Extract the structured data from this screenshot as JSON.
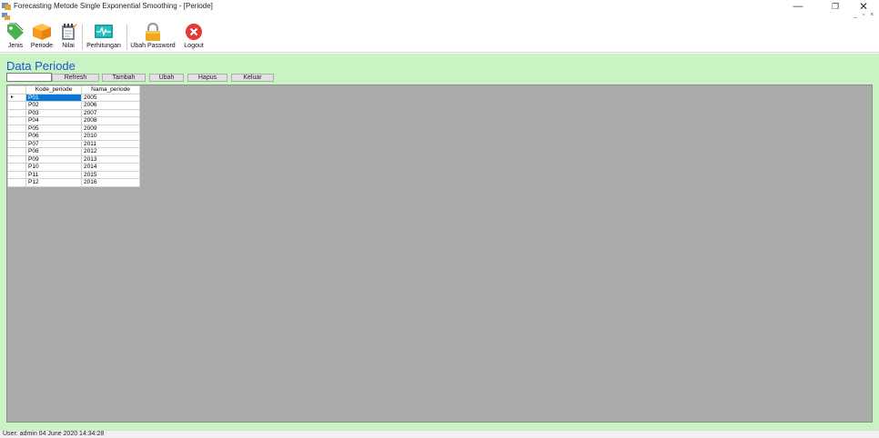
{
  "window": {
    "title": "Forecasting Metode Single Exponential Smoothing - [Periode]",
    "controls": {
      "minimize": "—",
      "restore": "❐",
      "close": "✕"
    },
    "mdi_controls": "_ ▫ ×"
  },
  "toolbar": {
    "items": [
      {
        "label": "Jenis",
        "icon": "tag-icon",
        "color": "#4caf50"
      },
      {
        "label": "Periode",
        "icon": "box-icon",
        "color": "#f5a623"
      },
      {
        "label": "Nilai",
        "icon": "notepad-icon",
        "color": "#7b8798"
      },
      {
        "label": "Perhitungan",
        "icon": "pulse-monitor-icon",
        "color": "#1aa3a3"
      },
      {
        "label": "Ubah Password",
        "icon": "padlock-icon",
        "color": "#f2a81d"
      },
      {
        "label": "Logout",
        "icon": "close-circle-icon",
        "color": "#e53935"
      }
    ]
  },
  "main": {
    "title": "Data Periode",
    "search_value": "",
    "buttons": {
      "refresh": "Refresh",
      "tambah": "Tambah",
      "ubah": "Ubah",
      "hapus": "Hapus",
      "keluar": "Keluar"
    },
    "grid": {
      "columns": [
        "Kode_periode",
        "Nama_periode"
      ],
      "selected_row_marker": "►",
      "rows": [
        [
          "P01",
          "2005"
        ],
        [
          "P02",
          "2006"
        ],
        [
          "P03",
          "2007"
        ],
        [
          "P04",
          "2008"
        ],
        [
          "P05",
          "2009"
        ],
        [
          "P06",
          "2010"
        ],
        [
          "P07",
          "2011"
        ],
        [
          "P08",
          "2012"
        ],
        [
          "P09",
          "2013"
        ],
        [
          "P10",
          "2014"
        ],
        [
          "P11",
          "2015"
        ],
        [
          "P12",
          "2016"
        ]
      ]
    }
  },
  "status": {
    "text": "User: admin  04 June 2020 14:34:28"
  },
  "colors": {
    "content_bg": "#c9f3c2",
    "title_blue": "#1f55d6",
    "selection": "#0a78d7",
    "grid_bg": "#ababab"
  }
}
